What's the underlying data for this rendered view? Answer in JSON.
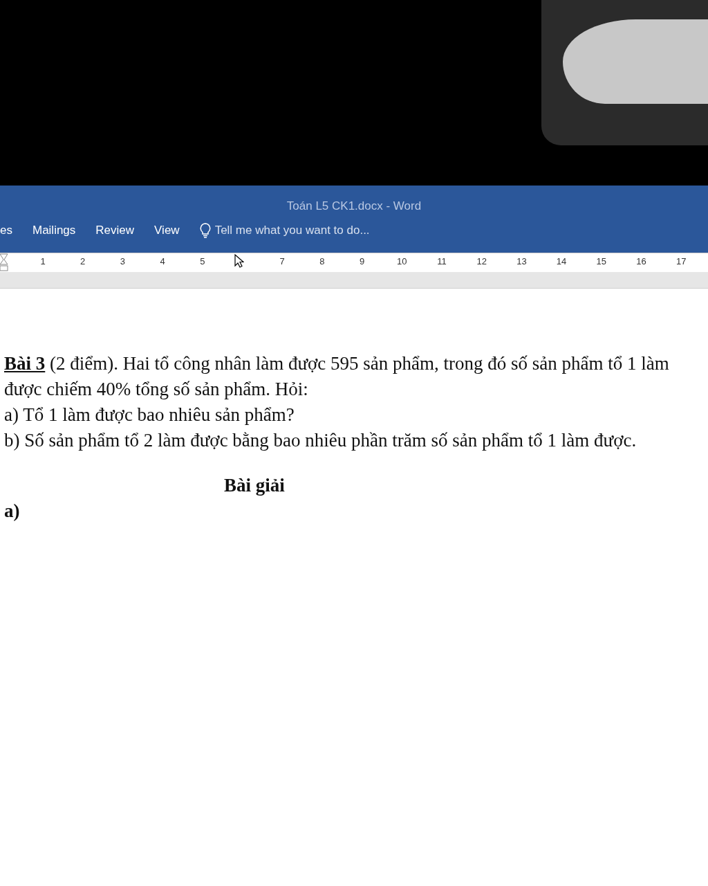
{
  "window": {
    "title": "Toán L5 CK1.docx - Word"
  },
  "tabs": [
    {
      "label": "es"
    },
    {
      "label": "Mailings"
    },
    {
      "label": "Review"
    },
    {
      "label": "View"
    }
  ],
  "tell_me": {
    "placeholder": "Tell me what you want to do..."
  },
  "ruler": {
    "marks": [
      {
        "kind": "number",
        "label": "1"
      },
      {
        "kind": "number",
        "label": "2"
      },
      {
        "kind": "number",
        "label": "3"
      },
      {
        "kind": "number",
        "label": "4"
      },
      {
        "kind": "number",
        "label": "5"
      },
      {
        "kind": "cursor"
      },
      {
        "kind": "number",
        "label": "7"
      },
      {
        "kind": "number",
        "label": "8"
      },
      {
        "kind": "number",
        "label": "9"
      },
      {
        "kind": "number",
        "label": "10"
      },
      {
        "kind": "number",
        "label": "11"
      },
      {
        "kind": "number",
        "label": "12"
      },
      {
        "kind": "number",
        "label": "13"
      },
      {
        "kind": "number",
        "label": "14"
      },
      {
        "kind": "number",
        "label": "15"
      },
      {
        "kind": "number",
        "label": "16"
      },
      {
        "kind": "number",
        "label": "17"
      }
    ]
  },
  "document": {
    "lines": [
      {
        "kind": "text",
        "text": "**Bài 3** (2 điểm). Hai tổ công nhân làm được 595 sản phẩm, trong đó số sản phẩm tổ 1 làm"
      },
      {
        "kind": "text",
        "text": "được chiếm 40% tổng số sản phẩm. Hỏi:"
      },
      {
        "kind": "text",
        "text": "a) Tổ 1 làm được bao nhiêu sản phẩm?"
      },
      {
        "kind": "text",
        "text": "b) Số sản phẩm tổ 2 làm được bằng bao nhiêu phần trăm số sản phẩm tổ 1 làm được."
      },
      {
        "kind": "heading",
        "text": "Bài giải"
      },
      {
        "kind": "label",
        "text": "a)"
      }
    ]
  }
}
